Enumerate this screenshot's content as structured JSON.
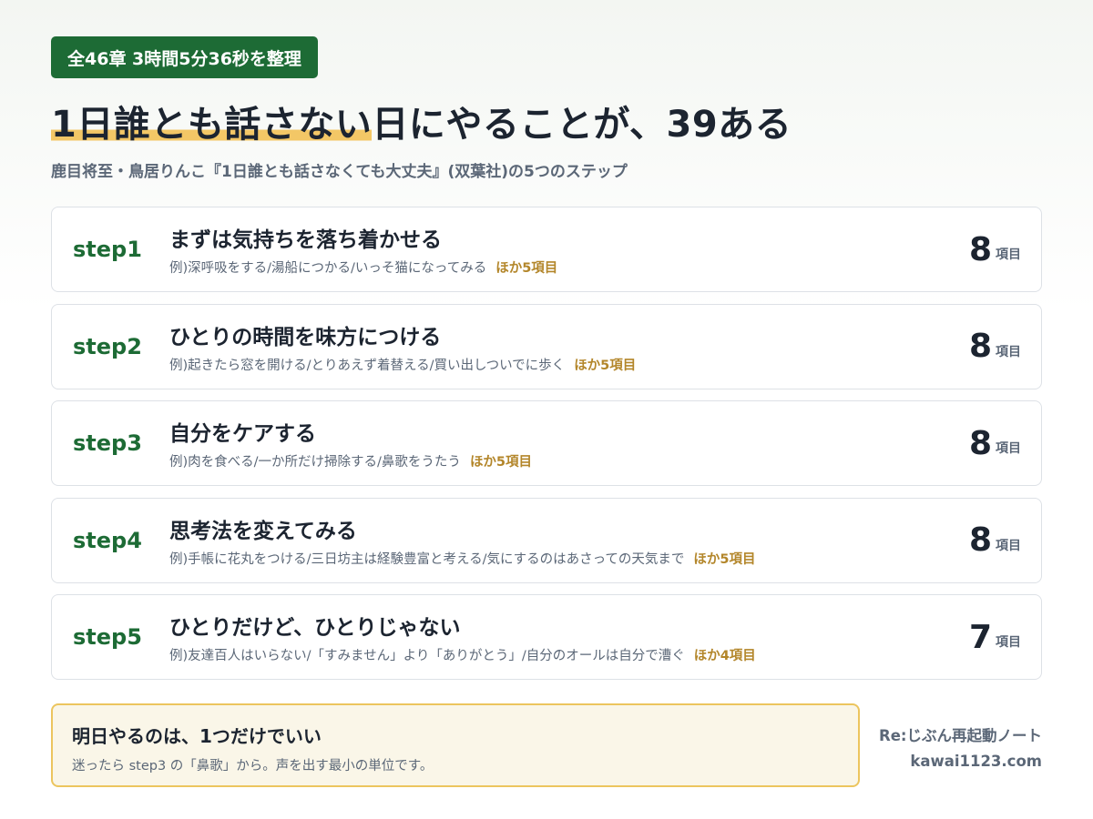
{
  "badge": "全46章 3時間5分36秒を整理",
  "title": {
    "highlight": "1日誰とも話さない",
    "rest": "日にやることが、39ある"
  },
  "subtitle": "鹿目将至・鳥居りんこ『1日誰とも話さなくても大丈夫』(双葉社)の5つのステップ",
  "steps": [
    {
      "label": "step1",
      "title": "まずは気持ちを落ち着かせる",
      "examples": "例)深呼吸をする/湯船につかる/いっそ猫になってみる",
      "more": "ほか5項目",
      "count": "8",
      "unit": "項目"
    },
    {
      "label": "step2",
      "title": "ひとりの時間を味方につける",
      "examples": "例)起きたら窓を開ける/とりあえず着替える/買い出しついでに歩く",
      "more": "ほか5項目",
      "count": "8",
      "unit": "項目"
    },
    {
      "label": "step3",
      "title": "自分をケアする",
      "examples": "例)肉を食べる/一か所だけ掃除する/鼻歌をうたう",
      "more": "ほか5項目",
      "count": "8",
      "unit": "項目"
    },
    {
      "label": "step4",
      "title": "思考法を変えてみる",
      "examples": "例)手帳に花丸をつける/三日坊主は経験豊富と考える/気にするのはあさっての天気まで",
      "more": "ほか5項目",
      "count": "8",
      "unit": "項目"
    },
    {
      "label": "step5",
      "title": "ひとりだけど、ひとりじゃない",
      "examples": "例)友達百人はいらない/「すみません」より「ありがとう」/自分のオールは自分で漕ぐ",
      "more": "ほか4項目",
      "count": "7",
      "unit": "項目"
    }
  ],
  "callout": {
    "title": "明日やるのは、1つだけでいい",
    "body": "迷ったら step3 の「鼻歌」から。声を出す最小の単位です。"
  },
  "brand": {
    "name": "Re:じぶん再起動ノート",
    "url": "kawai1123.com"
  },
  "colors": {
    "accent_green": "#1d6b35",
    "highlight_yellow": "#f3c766",
    "more_gold": "#b3862a",
    "callout_bg": "#faf6e8",
    "callout_border": "#ecc55e"
  }
}
